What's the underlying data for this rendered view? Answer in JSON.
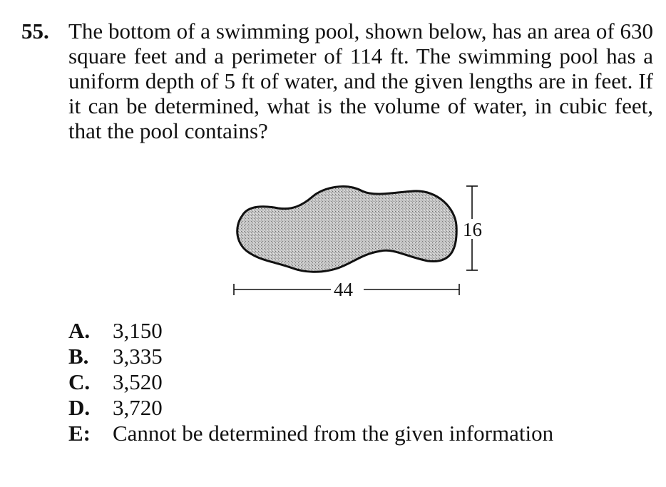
{
  "question": {
    "number": "55.",
    "text": "The bottom of a swimming pool, shown below, has an area of 630 square feet and a perimeter of 114 ft. The swimming pool has a uniform depth of 5 ft of water, and the given lengths are in feet. If it can be determined, what is the volume of water, in cubic feet, that the pool contains?"
  },
  "figure": {
    "width_label": "44",
    "height_label": "16",
    "fill_color": "#b9b9b9",
    "outline_color": "#111111"
  },
  "choices": [
    {
      "letter": "A.",
      "text": "3,150"
    },
    {
      "letter": "B.",
      "text": "3,335"
    },
    {
      "letter": "C.",
      "text": "3,520"
    },
    {
      "letter": "D.",
      "text": "3,720"
    },
    {
      "letter": "E:",
      "text": "Cannot be determined from the given information"
    }
  ]
}
